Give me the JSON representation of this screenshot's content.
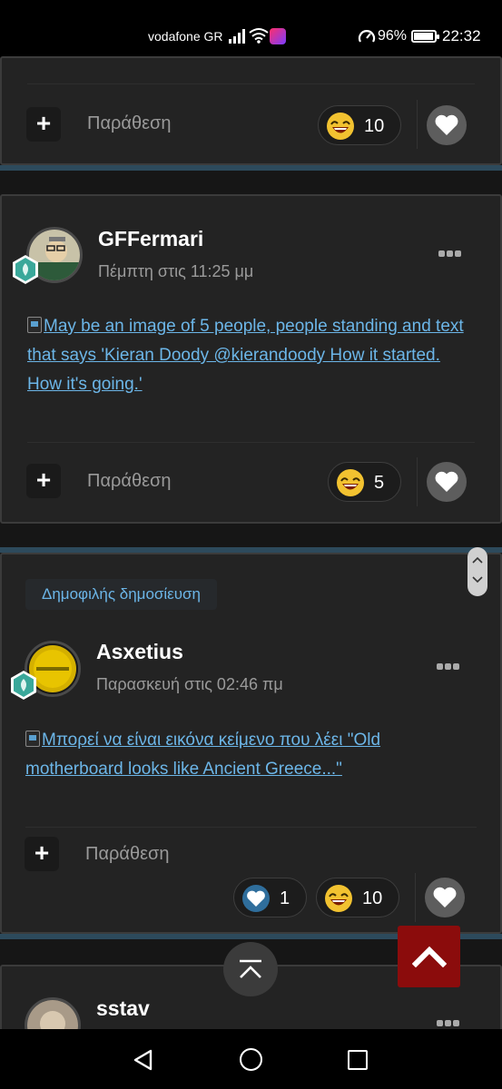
{
  "status_bar": {
    "carrier": "vodafone GR",
    "battery_percent": "96%",
    "battery_level": 0.96,
    "time": "22:32"
  },
  "posts": [
    {
      "quote_label": "Παράθεση",
      "reactions": [
        {
          "icon": "grin-emoji-icon",
          "count": "10"
        }
      ]
    },
    {
      "author": "GFFermari",
      "date": "Πέμπτη στις 11:25 μμ",
      "image_alt": "May be an image of 5 people, people standing and text that says 'Kieran Doody @kierandoody How it started. How it's going.'",
      "quote_label": "Παράθεση",
      "reactions": [
        {
          "icon": "grin-emoji-icon",
          "count": "5"
        }
      ]
    },
    {
      "popular_tag": "Δημοφιλής δημοσίευση",
      "author": "Asxetius",
      "date": "Παρασκευή στις 02:46 πμ",
      "image_alt": "Μπορεί να είναι εικόνα κείμενο που λέει \"Old motherboard looks like Ancient Greece...\"",
      "quote_label": "Παράθεση",
      "reactions": [
        {
          "icon": "like-heart-icon",
          "count": "1"
        },
        {
          "icon": "grin-emoji-icon",
          "count": "10"
        }
      ]
    },
    {
      "author": "sstav"
    }
  ],
  "colors": {
    "accent_link": "#6cb6e8",
    "back_to_top_red": "#8b0c0c",
    "post_bg": "#232323"
  }
}
